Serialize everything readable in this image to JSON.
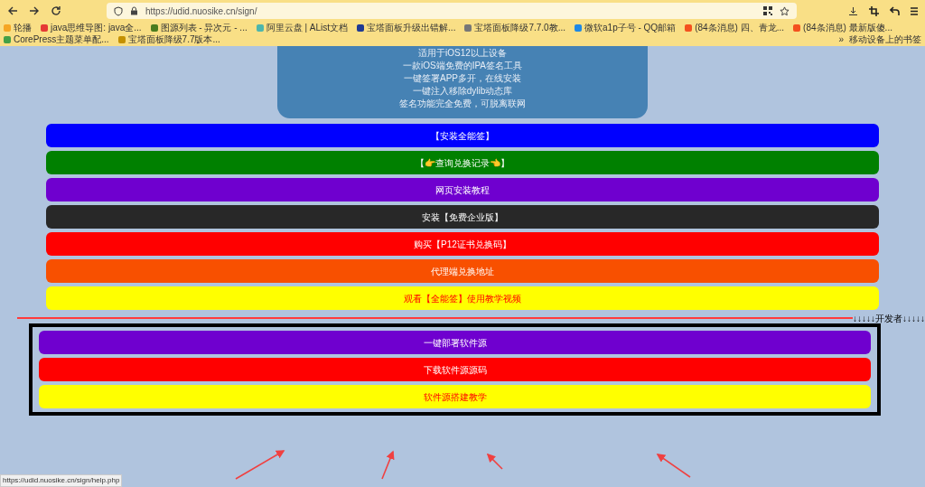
{
  "browser": {
    "url": "https://udid.nuosike.cn/sign/",
    "bookmarks": [
      {
        "label": "轮播",
        "color": "#f5a623"
      },
      {
        "label": "java思维导图: java全...",
        "color": "#e53935"
      },
      {
        "label": "图源列表 - 异次元 - ...",
        "color": "#4a7c1f"
      },
      {
        "label": "阿里云盘 | AList文档",
        "color": "#4db6ac"
      },
      {
        "label": "宝塔面板升级出错解...",
        "color": "#1f3a93"
      },
      {
        "label": "宝塔面板降级7.7.0教...",
        "color": "#777777"
      },
      {
        "label": "微软a1p子号 - QQ邮箱",
        "color": "#1e88e5"
      },
      {
        "label": "(84条消息) 四、青龙...",
        "color": "#f4511e"
      },
      {
        "label": "(84条消息) 最新版傻...",
        "color": "#f4511e"
      },
      {
        "label": "CorePress主题菜单配...",
        "color": "#43a047"
      },
      {
        "label": "宝塔面板降级7.7版本...",
        "color": "#c49000"
      }
    ],
    "overflow": "»",
    "mobile_bookmarks": "移动设备上的书签"
  },
  "intro_lines": [
    "适用于iOS12以上设备",
    "一款iOS端免费的IPA签名工具",
    "一键签署APP多开，在线安装",
    "一键注入移除dylib动态库",
    "签名功能完全免费，可脱离联网"
  ],
  "buttons": [
    {
      "label": "【安装全能签】",
      "color": "#0000ff"
    },
    {
      "label": "【👉查询兑换记录👈】",
      "color": "#008000"
    },
    {
      "label": "网页安装教程",
      "color": "#6f00cf"
    },
    {
      "label": "安装【免费企业版】",
      "color": "#282828"
    },
    {
      "label": "购买【P12证书兑换码】",
      "color": "#ff0000"
    },
    {
      "label": "代理端兑换地址",
      "color": "#f85000"
    },
    {
      "label": "观看【全能签】使用教学视频",
      "color": "#ffff00"
    }
  ],
  "developer_label": "↓↓↓↓↓开发者↓↓↓↓↓",
  "developer_buttons": [
    {
      "label": "一键部署软件源",
      "color": "#6f00cf"
    },
    {
      "label": "下载软件源源码",
      "color": "#ff0000"
    },
    {
      "label": "软件源搭建教学",
      "color": "#ffff00"
    }
  ],
  "status_url": "https://udid.nuosike.cn/sign/help.php"
}
